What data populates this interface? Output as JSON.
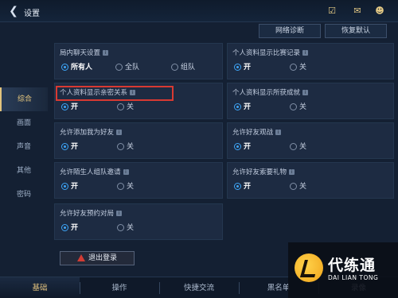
{
  "header": {
    "title": "设置",
    "icons": [
      "task-icon",
      "chat-icon",
      "friends-icon"
    ]
  },
  "actions": {
    "network_diag": "网络诊断",
    "restore_default": "恢复默认"
  },
  "sidebar": {
    "items": [
      {
        "label": "综合",
        "active": true
      },
      {
        "label": "画面",
        "active": false
      },
      {
        "label": "声音",
        "active": false
      },
      {
        "label": "其他",
        "active": false
      },
      {
        "label": "密码",
        "active": false
      }
    ]
  },
  "settings": {
    "chat": {
      "label": "局内聊天设置",
      "options": [
        "所有人",
        "全队",
        "组队"
      ],
      "selected": "所有人"
    },
    "show_record": {
      "label": "个人资料显示比赛记录",
      "options": [
        "开",
        "关"
      ],
      "selected": "开"
    },
    "show_intimacy": {
      "label": "个人资料显示亲密关系",
      "options": [
        "开",
        "关"
      ],
      "selected": "开"
    },
    "show_achievement": {
      "label": "个人资料显示所获成就",
      "options": [
        "开",
        "关"
      ],
      "selected": "开"
    },
    "allow_add_friend": {
      "label": "允许添加我为好友",
      "options": [
        "开",
        "关"
      ],
      "selected": "开"
    },
    "allow_friend_watch": {
      "label": "允许好友观战",
      "options": [
        "开",
        "关"
      ],
      "selected": "开"
    },
    "allow_stranger_invite": {
      "label": "允许陌生人组队邀请",
      "options": [
        "开",
        "关"
      ],
      "selected": "开"
    },
    "allow_friend_gift": {
      "label": "允许好友索要礼物",
      "options": [
        "开",
        "关"
      ],
      "selected": "开"
    },
    "allow_friend_reserve": {
      "label": "允许好友预约对局",
      "options": [
        "开",
        "关"
      ],
      "selected": "开"
    }
  },
  "logout_label": "退出登录",
  "bottom_tabs": [
    {
      "label": "基础",
      "active": true
    },
    {
      "label": "操作",
      "active": false
    },
    {
      "label": "快捷交流",
      "active": false
    },
    {
      "label": "黑名单",
      "active": false
    },
    {
      "label": "录像",
      "active": false
    }
  ],
  "watermark": {
    "brand": "代练通",
    "sub": "DAI LIAN TONG"
  },
  "colors": {
    "accent_gold": "#e3c47d",
    "radio_blue": "#3ea5f7",
    "highlight_red": "#d83a32"
  }
}
